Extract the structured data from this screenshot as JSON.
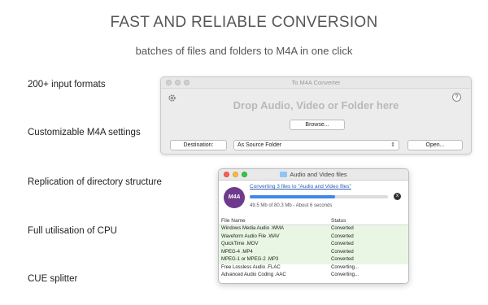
{
  "headline": "FAST AND RELIABLE CONVERSION",
  "subline": "batches of files and folders to M4A in one click",
  "features": [
    "200+ input formats",
    "Customizable M4A settings",
    "Replication of directory structure",
    "Full utilisation of CPU",
    "CUE splitter"
  ],
  "main_window": {
    "title": "To M4A Converter",
    "drop_text": "Drop Audio, Video or Folder here",
    "help_label": "?",
    "browse_label": "Browse...",
    "destination_label": "Destination:",
    "destination_value": "As Source Folder",
    "open_label": "Open..."
  },
  "progress_window": {
    "title": "Audio and Video files",
    "icon_text": "M4A",
    "link_text": "Converting 3 files to \"Audio and Video files\"",
    "progress_fraction": 0.62,
    "size_info": "49.5 Mb of 80.3 Mb - About 6 seconds",
    "stop_icon": "x",
    "columns": [
      "File Name",
      "Status"
    ],
    "rows": [
      {
        "name": "Windows Media Audio .WMA",
        "status": "Converted"
      },
      {
        "name": "Waveform Audio File .WAV",
        "status": "Converted"
      },
      {
        "name": "QuickTime .MOV",
        "status": "Converted"
      },
      {
        "name": "MPEG-4 .MP4",
        "status": "Converted"
      },
      {
        "name": "MPEG-1 or MPEG-2 .MP3",
        "status": "Converted"
      },
      {
        "name": "Free Lossless Audio .FLAC",
        "status": "Converting..."
      },
      {
        "name": "Advanced Audio Coding .AAC",
        "status": "Converting..."
      }
    ]
  }
}
